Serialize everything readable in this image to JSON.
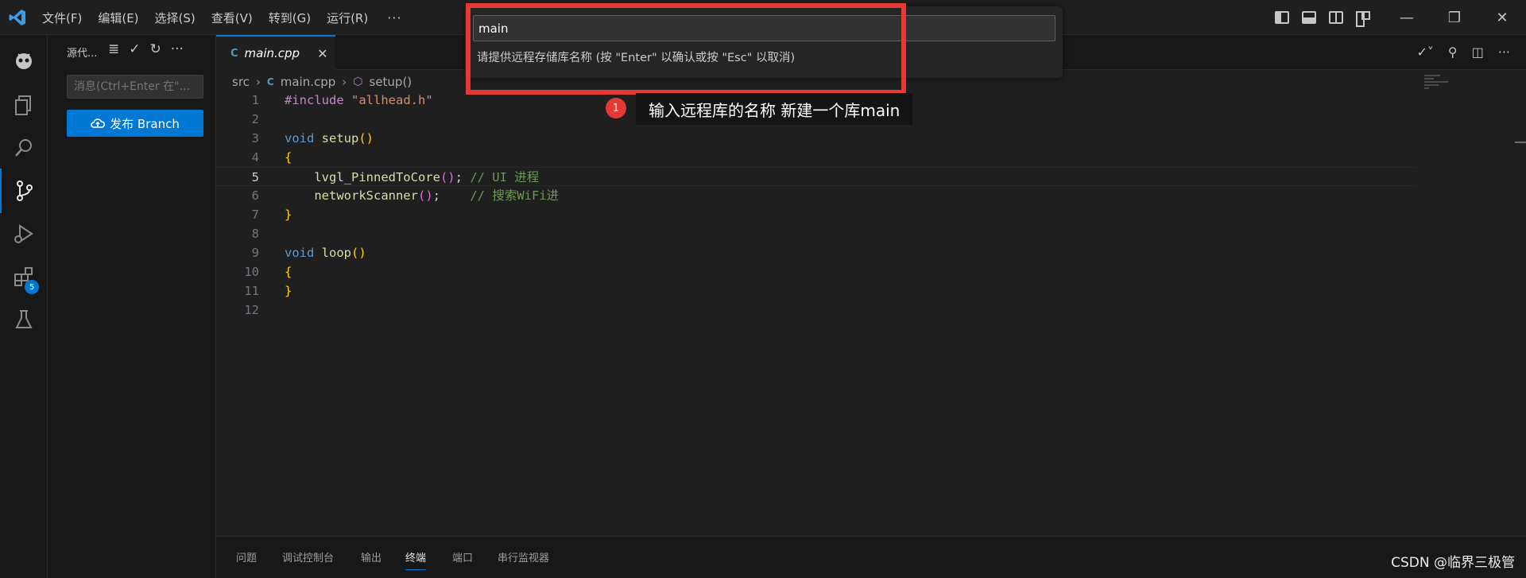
{
  "titlebar": {
    "menus": [
      "文件(F)",
      "编辑(E)",
      "选择(S)",
      "查看(V)",
      "转到(G)",
      "运行(R)"
    ],
    "more": "···",
    "window_buttons": {
      "minimize": "—",
      "restore": "❐",
      "close": "✕"
    }
  },
  "activitybar": {
    "items": [
      "platformio-icon",
      "explorer-icon",
      "search-icon",
      "source-control-icon",
      "run-debug-icon",
      "extensions-icon",
      "testing-icon"
    ],
    "extensions_badge": "5"
  },
  "sidebar": {
    "title": "源代...",
    "tools": [
      "≣",
      "✓",
      "↻",
      "···"
    ],
    "message_placeholder": "消息(Ctrl+Enter 在\"...",
    "publish_label": "发布 Branch"
  },
  "editor": {
    "tab_title": "main.cpp",
    "tab_icon": "C",
    "tab_close": "✕",
    "actions": [
      "✓˅",
      "⚲",
      "◫",
      "···"
    ],
    "breadcrumb": {
      "folder": "src",
      "file": "main.cpp",
      "symbol": "setup()"
    },
    "line_numbers": [
      "1",
      "2",
      "3",
      "4",
      "5",
      "6",
      "7",
      "8",
      "9",
      "10",
      "11",
      "12"
    ],
    "current_line": 5,
    "code": {
      "l1_directive": "#include",
      "l1_string": "\"allhead.h\"",
      "l3_kw": "void",
      "l3_fn": "setup",
      "l5_fn": "lvgl_PinnedToCore",
      "l5_comment": "// UI 进程",
      "l6_fn": "networkScanner",
      "l6_comment": "// 搜索WiFi进",
      "l9_kw": "void",
      "l9_fn": "loop"
    }
  },
  "quick_input": {
    "value": "main",
    "message": "请提供远程存储库名称 (按 \"Enter\" 以确认或按 \"Esc\" 以取消)"
  },
  "annotation": {
    "number": "1",
    "text": "输入远程库的名称  新建一个库main",
    "color": "#e53935"
  },
  "panel": {
    "tabs": [
      "问题",
      "调试控制台",
      "输出",
      "终端",
      "端口",
      "串行监视器"
    ],
    "active_tab": "终端"
  },
  "watermark": "CSDN @临界三极管",
  "colors": {
    "accent": "#0078d4",
    "background": "#1f1f1f"
  }
}
